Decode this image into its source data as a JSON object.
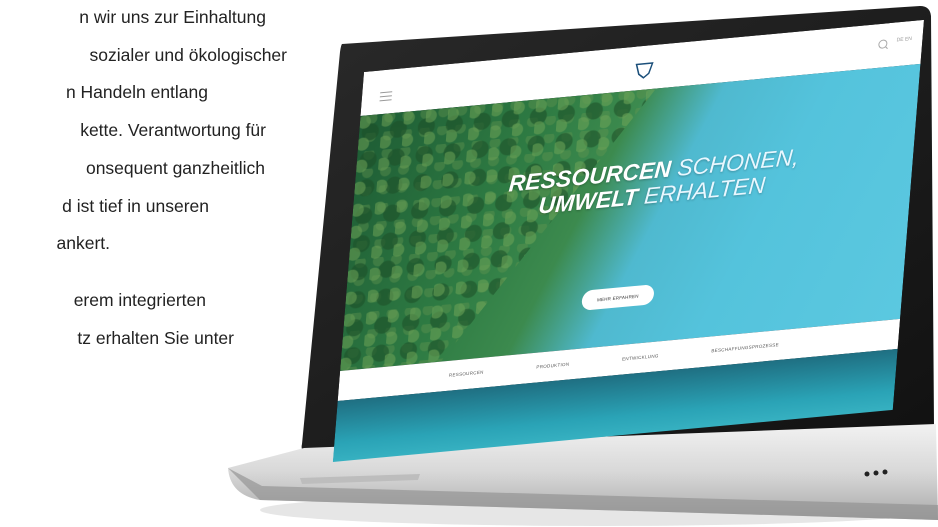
{
  "page_text": {
    "lines": [
      "n wir uns zur Einhaltung",
      "sozialer und ökologischer",
      "n Handeln entlang",
      "kette. Verantwortung für",
      "onsequent ganzheitlich",
      "d ist tief in unseren",
      "ankert.",
      "",
      "erem integrierten",
      "tz erhalten Sie unter"
    ]
  },
  "website": {
    "hero": {
      "title_line1_bold": "RESSOURCEN",
      "title_line1_light": "SCHONEN,",
      "title_line2_bold": "UMWELT",
      "title_line2_light": "ERHALTEN",
      "button_label": "MEHR ERFAHREN"
    },
    "nav": {
      "items": [
        "RESSOURCEN",
        "PRODUKTION",
        "ENTWICKLUNG",
        "BESCHAFFUNGSPROZESSE"
      ]
    },
    "lang_label": "DE EN"
  },
  "colors": {
    "forest": "#2e7b43",
    "water": "#54c3dc",
    "laptop_frame": "#1b1b1b",
    "laptop_base": "#d9d9d9"
  }
}
